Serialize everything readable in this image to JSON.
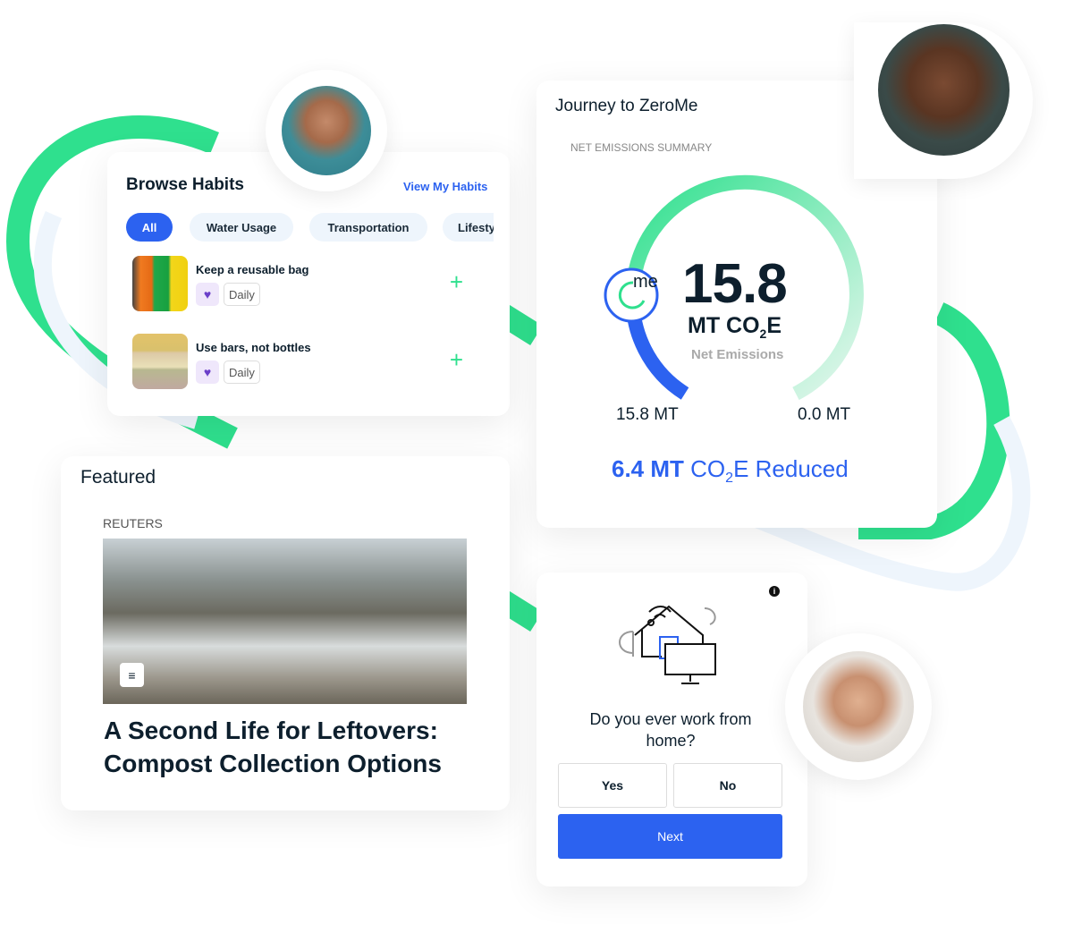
{
  "habits_card": {
    "title": "Browse Habits",
    "view_link": "View My Habits",
    "filters": [
      "All",
      "Water Usage",
      "Transportation",
      "Lifesty"
    ],
    "items": [
      {
        "title": "Keep a reusable bag",
        "frequency": "Daily",
        "icon": "heart-pulse-icon"
      },
      {
        "title": "Use bars, not bottles",
        "frequency": "Daily",
        "icon": "heart-pulse-icon"
      }
    ]
  },
  "journey_card": {
    "title": "Journey to ZeroMe",
    "subtitle": "NET EMISSIONS SUMMARY",
    "logo_text": "me",
    "value": "15.8",
    "unit": "MT CO",
    "unit_sub": "2",
    "unit_end": "E",
    "caption": "Net Emissions",
    "start_label": "15.8 MT",
    "end_label": "0.0 MT",
    "reduced_value": "6.4 MT",
    "reduced_unit": " CO",
    "reduced_sub": "2",
    "reduced_end": "E Reduced",
    "progress_fraction": 0.29,
    "colors": {
      "blue": "#2c62f0",
      "green": "#2fe08e"
    }
  },
  "featured_card": {
    "title": "Featured",
    "source": "REUTERS",
    "headline": "A Second Life for Leftovers: Compost Collection Options",
    "badge_icon": "article-icon"
  },
  "question_card": {
    "question": "Do you ever work from home?",
    "yes": "Yes",
    "no": "No",
    "next": "Next",
    "icon": "smart-home-icon",
    "info_icon": "info-icon"
  },
  "colors": {
    "accent": "#2c62f0",
    "ribbon": "#2fe08e"
  }
}
